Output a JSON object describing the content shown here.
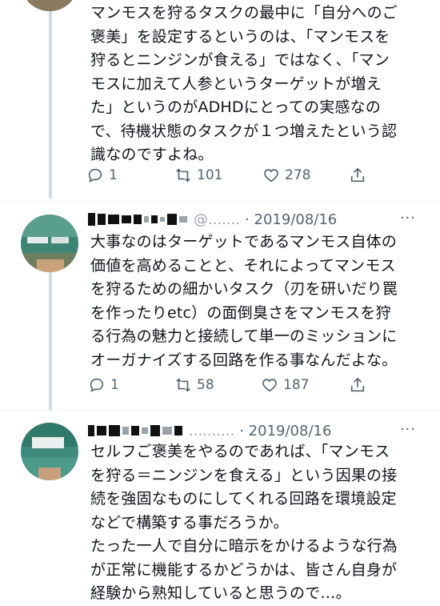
{
  "tweets": [
    {
      "text": "マンモスを狩るタスクの最中に「自分へのご\n褒美」を設定するというのは、「マンモスを\n狩るとニンジンが食える」ではなく、「マン\nモスに加えて人参というターゲットが増え\nた」というのがADHDにとっての実感なの\nで、待機状態のタスクが１つ増えたという認\n識なのですよね。",
      "reply_count": "1",
      "retweet_count": "101",
      "like_count": "278"
    },
    {
      "name_mosaic": "█▘▚▞▗▚ ▗ ▖▝ ▄▘",
      "handle_tail": "@.......",
      "date": "· 2019/08/16",
      "more": "···",
      "text": "大事なのはターゲットであるマンモス自体の\n価値を高めることと、それによってマンモス\nを狩るための細かいタスク（刃を研いだり罠\nを作ったりetc）の面倒臭さをマンモスを狩\nる行為の魅力と接続して単一のミッションに\nオーガナイズする回路を作る事なんだよな。",
      "reply_count": "1",
      "retweet_count": "58",
      "like_count": "187"
    },
    {
      "name_mosaic": "▞▚▄ ▗▖▘ ▝ ▖▗",
      "handle_tail": "..........",
      "date": "· 2019/08/16",
      "more": "···",
      "text": "セルフご褒美をやるのであれば、「マンモス\nを狩る＝ニンジンを食える」という因果の接\n続を強固なものにしてくれる回路を環境設定\nなどで構築する事だろうか。\nたった一人で自分に暗示をかけるような行為\nが正常に機能するかどうかは、皆さん自身が\n経験から熟知していると思うので…。"
    }
  ],
  "icons": [
    "reply-icon",
    "retweet-icon",
    "like-icon",
    "share-icon",
    "more-icon"
  ],
  "colors": {
    "text": "#0f1419",
    "muted": "#536471",
    "thread": "#cfd9de",
    "avatar": "#3f8a7c"
  }
}
